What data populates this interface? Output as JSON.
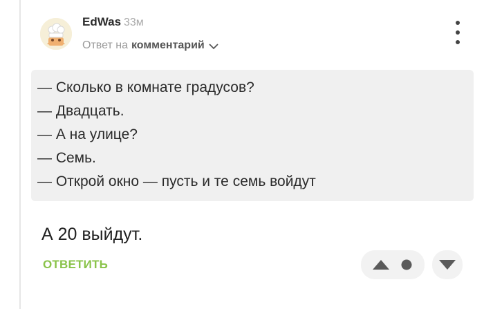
{
  "comment": {
    "author": "EdWas",
    "time": "33м",
    "reply_prefix": "Ответ на",
    "reply_target": "комментарий",
    "quote_lines": [
      "— Сколько в комнате градусов?",
      "— Двадцать.",
      "— А на улице?",
      "— Семь.",
      "— Открой окно — пусть и те семь войдут"
    ],
    "text": "А 20 выйдут.",
    "reply_label": "ОТВЕТИТЬ"
  },
  "icons": {
    "avatar": "avatar-chef-icon",
    "reply_chevron": "chevron-down-icon",
    "more": "more-vertical-icon",
    "upvote": "triangle-up-icon",
    "rating": "dot-icon",
    "downvote": "triangle-down-icon"
  },
  "colors": {
    "accent_green": "#8ac34a",
    "quote_bg": "#f0f0f0",
    "button_bg": "#f2f2f2"
  }
}
